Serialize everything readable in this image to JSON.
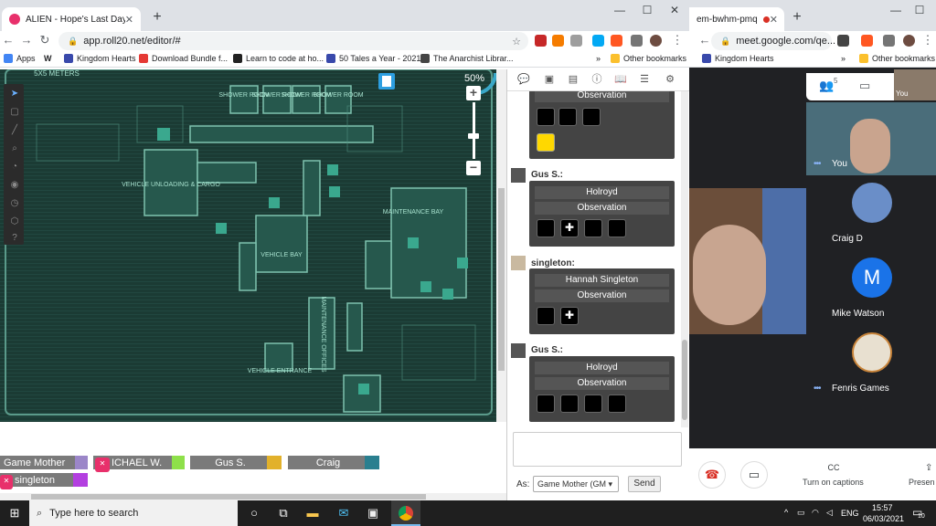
{
  "left_browser": {
    "tab_title": "ALIEN - Hope's Last Day | Roll20",
    "url": "app.roll20.net/editor/#",
    "bookmarks": [
      "Apps",
      "Kingdom Hearts",
      "Download Bundle f...",
      "Learn to code at ho...",
      "50 Tales a Year - 2021",
      "The Anarchist Librar...",
      "Other bookmarks"
    ],
    "bookmark_overflow": "»"
  },
  "map": {
    "zoom": "50%",
    "labels": {
      "scale": "5X5 METERS",
      "shower1": "SHOWER ROOM",
      "shower2": "SHOWER ROOM",
      "shower3": "SHOWER ROOM",
      "shower4": "SHOWER ROOM",
      "vehicle_unloading": "VEHICLE UNLOADING & CARGO",
      "vehicle_bay": "VEHICLE BAY",
      "maintenance_bay": "MAINTENANCE BAY",
      "maintenance_offices": "MAINTENANCE OFFICES",
      "vehicle_entrance": "VEHICLE ENTRANCE"
    }
  },
  "players": [
    {
      "name": "Game Mother",
      "color": "#9b86c8"
    },
    {
      "name": "ICHAEL W.",
      "color": "#8ee04a"
    },
    {
      "name": "Gus S.",
      "color": "#e2b12b"
    },
    {
      "name": "Craig",
      "color": "#2a7f8f"
    },
    {
      "name": "singleton",
      "color": "#b33fe0"
    }
  ],
  "chat": {
    "messages": [
      {
        "speaker": "",
        "line1": "",
        "line2": "Observation",
        "dice": [
          "",
          "",
          "",
          "yellow"
        ]
      },
      {
        "speaker": "Gus S.:",
        "line1": "Holroyd",
        "line2": "Observation",
        "dice": [
          "",
          "✚",
          "",
          ""
        ]
      },
      {
        "speaker": "singleton:",
        "line1": "Hannah Singleton",
        "line2": "Observation",
        "dice": [
          "",
          "✚"
        ]
      },
      {
        "speaker": "Gus S.:",
        "line1": "Holroyd",
        "line2": "Observation",
        "dice": [
          "",
          "",
          "",
          ""
        ]
      }
    ],
    "as_label": "As:",
    "as_value": "Game Mother (GM",
    "send_label": "Send"
  },
  "right_browser": {
    "tab_title": "em-bwhm-pmq",
    "url": "meet.google.com/qe...",
    "bookmarks": [
      "Kingdom Hearts",
      "Other bookmarks"
    ],
    "participant_count": "5"
  },
  "meet": {
    "self_label": "You",
    "self_label_top": "You",
    "participants": [
      "Craig D",
      "Mike Watson",
      "Fenris Games"
    ],
    "mike_initial": "M",
    "captions_label": "Turn on captions",
    "present_label": "Presen"
  },
  "taskbar": {
    "search_placeholder": "Type here to search",
    "language": "ENG",
    "time": "15:57",
    "date": "06/03/2021",
    "notification_count": "10"
  }
}
